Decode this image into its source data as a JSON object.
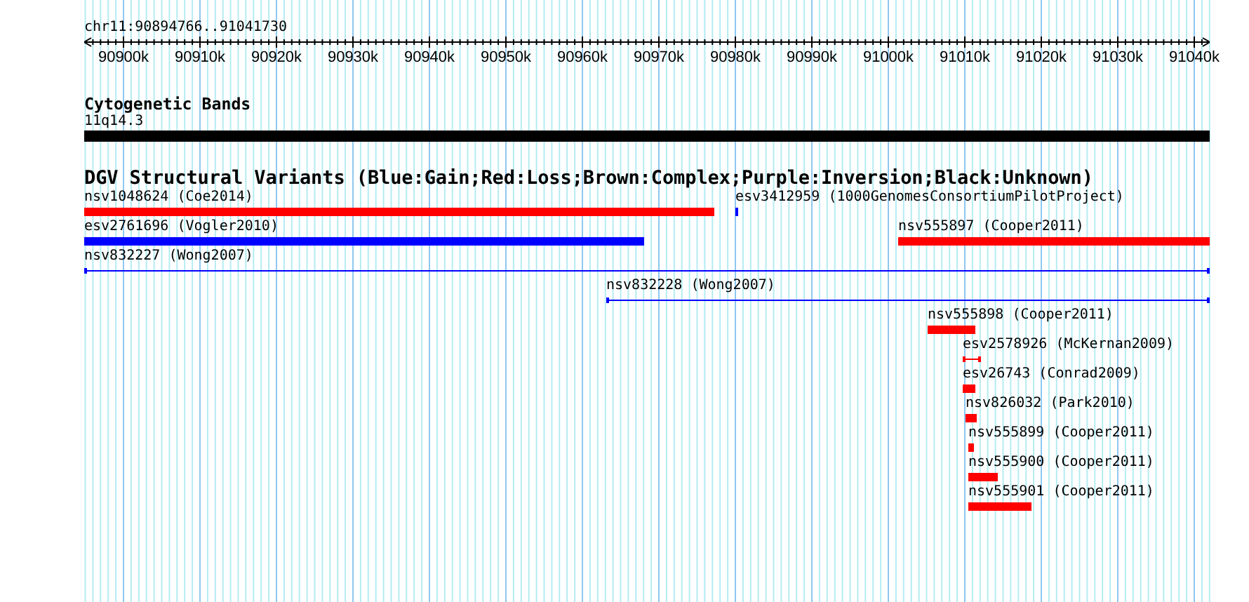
{
  "ruler": {
    "position": "chr11:90894766..91041730",
    "ticks": [
      "90900k",
      "90910k",
      "90920k",
      "90930k",
      "90940k",
      "90950k",
      "90960k",
      "90970k",
      "90980k",
      "90990k",
      "91000k",
      "91010k",
      "91020k",
      "91030k",
      "91040k"
    ]
  },
  "cytoband_track": {
    "title": "Cytogenetic Bands",
    "band": "11q14.3"
  },
  "dgv_track": {
    "title": "DGV Structural Variants (Blue:Gain;Red:Loss;Brown:Complex;Purple:Inversion;Black:Unknown)",
    "variants": [
      {
        "label": "nsv1048624 (Coe2014)",
        "color": "#ff0000",
        "kind": "bar"
      },
      {
        "label": "esv3412959 (1000GenomesConsortiumPilotProject)",
        "color": "#0000ff",
        "kind": "bar"
      },
      {
        "label": "esv2761696 (Vogler2010)",
        "color": "#0000ff",
        "kind": "bar"
      },
      {
        "label": "nsv555897 (Cooper2011)",
        "color": "#ff0000",
        "kind": "bar"
      },
      {
        "label": "nsv832227 (Wong2007)",
        "color": "#0000ff",
        "kind": "line"
      },
      {
        "label": "nsv832228 (Wong2007)",
        "color": "#0000ff",
        "kind": "line"
      },
      {
        "label": "nsv555898 (Cooper2011)",
        "color": "#ff0000",
        "kind": "bar"
      },
      {
        "label": "esv2578926 (McKernan2009)",
        "color": "#ff0000",
        "kind": "line"
      },
      {
        "label": "esv26743 (Conrad2009)",
        "color": "#ff0000",
        "kind": "bar"
      },
      {
        "label": "nsv826032 (Park2010)",
        "color": "#ff0000",
        "kind": "bar"
      },
      {
        "label": "nsv555899 (Cooper2011)",
        "color": "#ff0000",
        "kind": "bar"
      },
      {
        "label": "nsv555900 (Cooper2011)",
        "color": "#ff0000",
        "kind": "bar"
      },
      {
        "label": "nsv555901 (Cooper2011)",
        "color": "#ff0000",
        "kind": "bar"
      }
    ]
  }
}
